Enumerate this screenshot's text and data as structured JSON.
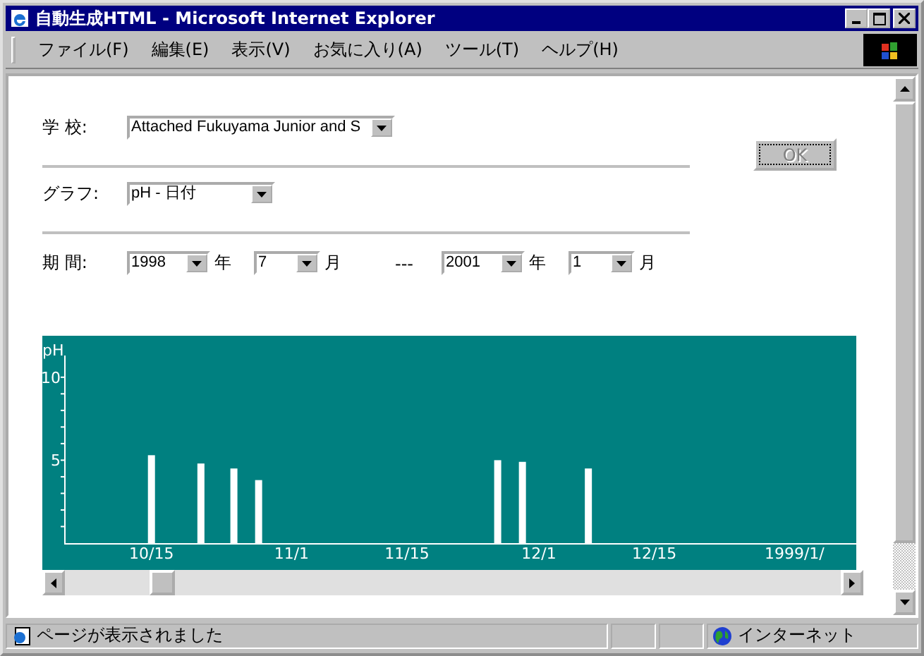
{
  "window": {
    "title": "自動生成HTML - Microsoft Internet Explorer"
  },
  "menu": [
    "ファイル(F)",
    "編集(E)",
    "表示(V)",
    "お気に入り(A)",
    "ツール(T)",
    "ヘルプ(H)"
  ],
  "form": {
    "school": {
      "label": "学 校:",
      "value": "Attached Fukuyama Junior and S"
    },
    "graph": {
      "label": "グラフ:",
      "value": "pH - 日付"
    },
    "period": {
      "label": "期 間:",
      "parts": [
        {
          "kind": "select",
          "value": "1998",
          "wide": true
        },
        {
          "kind": "unit",
          "text": "年"
        },
        {
          "kind": "select",
          "value": "7",
          "wide": false
        },
        {
          "kind": "unit",
          "text": "月"
        },
        {
          "kind": "separator",
          "text": "---"
        },
        {
          "kind": "select",
          "value": "2001",
          "wide": true
        },
        {
          "kind": "unit",
          "text": "年"
        },
        {
          "kind": "select",
          "value": "1",
          "wide": false
        },
        {
          "kind": "unit",
          "text": "月"
        }
      ]
    }
  },
  "ok_button": {
    "label": "OK",
    "disabled": true
  },
  "chart": {
    "chart_data": {
      "type": "bar",
      "ylabel": "pH",
      "ylim": [
        0,
        12.5
      ],
      "yticks": [
        5,
        10
      ],
      "categories": [
        null,
        null,
        null,
        null,
        null,
        null,
        null,
        null,
        null,
        null,
        "10/15",
        null,
        null,
        null,
        null,
        null,
        null,
        null,
        null,
        null,
        null,
        null,
        null,
        null,
        null,
        null,
        null,
        "11/1",
        null,
        null,
        null,
        null,
        null,
        null,
        null,
        null,
        null,
        null,
        null,
        null,
        null,
        "11/15",
        null,
        null,
        null,
        null,
        null,
        null,
        null,
        null,
        null,
        null,
        null,
        null,
        null,
        null,
        null,
        "12/1",
        null,
        null,
        null,
        null,
        null,
        null,
        null,
        null,
        null,
        null,
        null,
        null,
        null,
        "12/15",
        null,
        null,
        null,
        null,
        null,
        null,
        null,
        null,
        null,
        null,
        null,
        null,
        null,
        null,
        null,
        null,
        "1999/1/",
        null,
        null,
        null,
        null,
        null,
        null,
        null
      ],
      "values": [
        null,
        null,
        null,
        null,
        null,
        null,
        null,
        null,
        null,
        null,
        5.3,
        null,
        null,
        null,
        null,
        null,
        4.8,
        null,
        null,
        null,
        4.5,
        null,
        null,
        3.8,
        null,
        null,
        null,
        null,
        null,
        null,
        null,
        null,
        null,
        null,
        null,
        null,
        null,
        null,
        null,
        null,
        null,
        null,
        null,
        null,
        null,
        null,
        null,
        null,
        null,
        null,
        null,
        null,
        5.0,
        null,
        null,
        4.9,
        null,
        null,
        null,
        null,
        null,
        null,
        null,
        4.5,
        null,
        null,
        null,
        null,
        null,
        null,
        null,
        null,
        null,
        null,
        null,
        null,
        null,
        null,
        null,
        null,
        null,
        null,
        null,
        null,
        null,
        null,
        null,
        null,
        null,
        null,
        null,
        null,
        null,
        null,
        null,
        null
      ]
    }
  },
  "status_bar": {
    "text": "ページが表示されました",
    "zone": "インターネット"
  }
}
